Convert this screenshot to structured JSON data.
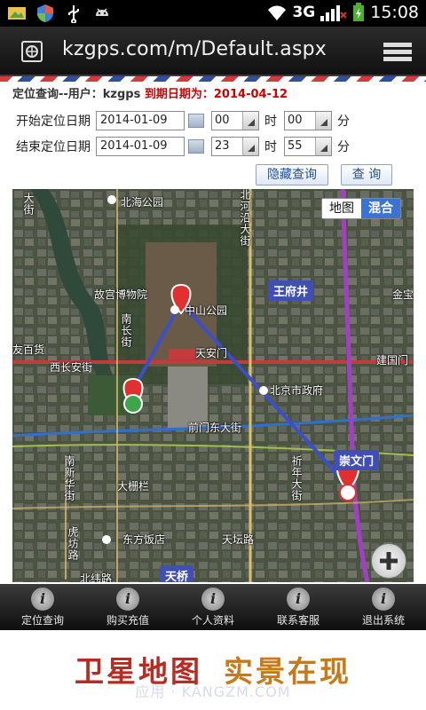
{
  "status_bar": {
    "time": "15:08",
    "network": "3G"
  },
  "browser": {
    "url": "kzgps.com/m/Default.aspx"
  },
  "header": {
    "title": "定位查询--用户：kzgps",
    "expiry": "到期日期为：2014-04-12"
  },
  "query_form": {
    "start_label": "开始定位日期",
    "start_date": "2014-01-09",
    "start_hour": "00",
    "start_minute": "00",
    "end_label": "结束定位日期",
    "end_date": "2014-01-09",
    "end_hour": "23",
    "end_minute": "55",
    "hour_unit": "时",
    "minute_unit": "分",
    "hide_button": "隐藏查询",
    "query_button": "查 询"
  },
  "map": {
    "toggle_map": "地图",
    "toggle_hybrid": "混合",
    "labels": {
      "beihai_park": "北海公园",
      "palace_museum": "故宫博物院",
      "zhongshan_park": "中山公园",
      "tiananmen": "天安门",
      "xichangan": "西长安街",
      "youbaihuo": "友百货",
      "beijing_gov": "北京市政府",
      "qianmen_east": "前门东大街",
      "jianguomen": "建国门",
      "dashilan": "大栅栏",
      "dongfang_hotel": "东方饭店",
      "tiantan_rd": "天坛路",
      "beiwei_rd": "北纬路",
      "dajie": "大街",
      "beiheyan": "北河沿大街",
      "nanchangjie": "南长街",
      "nanxinhua": "南新华街",
      "hufang": "虎坊路",
      "xinkai": "祈年大街",
      "jinbao": "金宝",
      "wangfujing": "王府井",
      "chongwenmen": "崇文门",
      "tianqiao": "天桥"
    },
    "route_color": "#3b4fc8",
    "metro_line_color": "#a33fc4",
    "road_color": "#c23c3c"
  },
  "bottom_nav": [
    {
      "label": "定位查询"
    },
    {
      "label": "购买充值"
    },
    {
      "label": "个人资料"
    },
    {
      "label": "联系客服"
    },
    {
      "label": "退出系统"
    }
  ],
  "caption": {
    "part1": "卫星地图",
    "part2": "实景在现"
  },
  "watermark": "应用 · KANGZM.COM"
}
